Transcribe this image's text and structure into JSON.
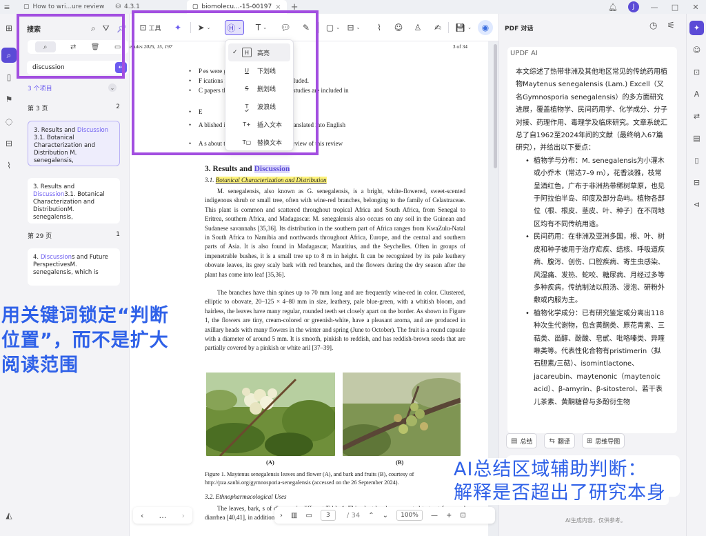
{
  "titlebar": {
    "tabs": [
      {
        "label": "How to wri...ure review",
        "active": false
      },
      {
        "label": "4.3.1",
        "active": false
      },
      {
        "label": "biomolecu...-15-00197",
        "active": true
      }
    ],
    "avatar_letter": "J"
  },
  "search_panel": {
    "title": "搜索",
    "query": "discussion",
    "result_count": "3 个项目",
    "groups": [
      {
        "page": "第 3 页",
        "count": "2"
      },
      {
        "page": "第 29 页",
        "count": "1"
      }
    ],
    "results": [
      {
        "pre": "3. Results and ",
        "match": "Discussion",
        "post": " 3.1. Botanical Characterization and Distribution M. senegalensis,"
      },
      {
        "pre": "3. Results and ",
        "match": "Discussion",
        "post": "3.1. Botanical Characterization and DistributionM. senegalensis,"
      },
      {
        "pre": "4. ",
        "match": "Discussion",
        "post": "s and Future PerspectivesM. senegalensis, which is"
      }
    ]
  },
  "toolbar": {
    "tools_label": "工具"
  },
  "highlight_menu": {
    "items": [
      {
        "icon": "H",
        "label": "高亮",
        "checked": true
      },
      {
        "icon": "U",
        "label": "下划线",
        "checked": false
      },
      {
        "icon": "S",
        "label": "删划线",
        "checked": false
      },
      {
        "icon": "T",
        "label": "波浪线",
        "checked": false
      },
      {
        "icon": "T+",
        "label": "插入文本",
        "checked": false
      },
      {
        "icon": "T▢",
        "label": "替换文本",
        "checked": false
      }
    ]
  },
  "document": {
    "running_head": "ecules 2025, 15, 197",
    "page_of": "3 of 34",
    "bullets": [
      "P                                   es were given preference.",
      "F                                   ications from 1962 to 2024 were included.",
      "C                                   papers that were first examined, 67 studies are included in",
      "E",
      "A                                   blished in English or could not be translated into English",
      "A                                   s about the plant, but beyond the purview of this review"
    ],
    "section_pre": "3. Results and ",
    "section_match": "Discussion",
    "subsection_num": "3.1. ",
    "subsection_title": "Botanical Characterization and Distribution",
    "para1": "M. senegalensis, also known as G. senegalensis, is a bright, white-flowered, sweet-scented indigenous shrub or small tree, often with wine-red branches, belonging to the family of Celastraceae. This plant is common and scattered throughout tropical Africa and South Africa, from Senegal to Eritrea, southern Africa, and Madagascar. M. senegalensis also occurs on any soil in the Guinean and Sudanese savannahs [35,36]. Its distribution in the southern part of Africa ranges from KwaZulu-Natal in South Africa to Namibia and northwards throughout Africa, Europe, and the central and southern parts of Asia. It is also found in Madagascar, Mauritius, and the Seychelles. Often in groups of impenetrable bushes, it is a small tree up to 8 m in height. It can be recognized by its pale leathery obovate leaves, its grey scaly bark with red branches, and the flowers during the dry season after the plant has come into leaf [35,36].",
    "para2": "The branches have thin spines up to 70 mm long and are frequently wine-red in color. Clustered, elliptic to obovate, 20–125 × 4–80 mm in size, leathery, pale blue-green, with a whitish bloom, and hairless, the leaves have many regular, rounded teeth set closely apart on the border. As shown in Figure 1, the flowers are tiny, cream-colored or greenish-white, have a pleasant aroma, and are produced in axillary heads with many flowers in the winter and spring (June to October). The fruit is a round capsule with a diameter of around 5 mm. It is smooth, pinkish to reddish, and has reddish-brown seeds that are partially covered by a pinkish or white aril [37–39].",
    "fig_a": "(A)",
    "fig_b": "(B)",
    "caption": "Figure 1. Maytenus senegalensis leaves and flower (A), and bark and fruits (B), courtesy of http://pza.sanbi.org/gymnosporia-senegalensis (accessed on the 26 September 2024).",
    "subsection2": "3.2. Ethnopharmacological Uses",
    "para3": "The leaves, bark, s                                                                        of diseases in different                                                                        Table 1. This plant has been reported to treat fever and diarrhea [40,41], in addition to"
  },
  "bottombar": {
    "page_current": "3",
    "page_total": "/ 34",
    "zoom": "100%"
  },
  "ai_panel": {
    "title": "PDF 对话",
    "card_title": "UPDF AI",
    "intro": "本文综述了热带非洲及其他地区常见的传统药用植物Maytenus senegalensis (Lam.) Excell（又名Gymnosporia senegalensis）的多方面研究进展，覆盖植物学、民间药用学、化学成分、分子对接、药理作用、毒理学及临床研究。文章系统汇总了自1962至2024年间的文献（最终纳入67篇研究），并给出以下要点：",
    "points": [
      "植物学与分布：M. senegalensis为小灌木或小乔木（常达7–9 m），花香淡雅，枝常呈酒红色，广布于非洲热带稀树草原，也见于阿拉伯半岛、印度及部分岛屿。植物各部位（根、根皮、茎皮、叶、种子）在不同地区均有不同传统用途。",
      "民间药用：在非洲及亚洲多国，根、叶、树皮和种子被用于治疗疟疾、结核、呼吸道疾病、腹泻、创伤、口腔疾病、寄生虫感染、风湿痛、发热、蛇咬、糖尿病、月经过多等多种疾病，传统制法以煎汤、浸泡、研粉外敷或内服为主。",
      "植物化学成分：已有研究鉴定或分离出118种次生代谢物，包含黄酮类、原花青素、三萜类、甾醇、酚酸、皂甙、吡咯嗪类、异喹啉类等。代表性化合物有pristimerin（拟石胆素/三萜）、isomintlactone、jacareubin、maytenonic（maytenoic acid）、β-amyrin、β-sitosterol、若干表儿茶素、黄酮糖苷与多酚衍生物"
    ],
    "actions": [
      "总结",
      "翻译",
      "思维导图"
    ],
    "footer": "AI生成内容，仅供参考。"
  },
  "annotations": {
    "left_callout": "用关键词锁定“判断位置”，而不是扩大阅读范围",
    "right_callout_line1": "AI总结区域辅助判断：",
    "right_callout_line2": "解释是否超出了研究本身"
  },
  "colors": {
    "accent": "#5b4bd6",
    "annotation_box": "#a24ee0",
    "annotation_text": "#2f61e8",
    "highlight_yellow": "#fdf27a"
  }
}
